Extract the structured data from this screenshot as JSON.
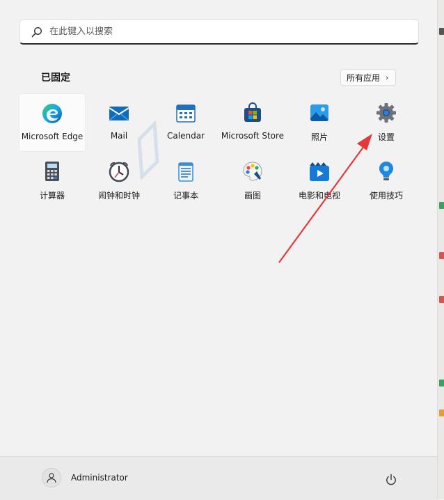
{
  "search": {
    "placeholder": "在此键入以搜索"
  },
  "pinned": {
    "title": "已固定",
    "all_apps_label": "所有应用",
    "apps": [
      {
        "label": "Microsoft Edge",
        "icon": "edge-icon"
      },
      {
        "label": "Mail",
        "icon": "mail-icon"
      },
      {
        "label": "Calendar",
        "icon": "calendar-icon"
      },
      {
        "label": "Microsoft Store",
        "icon": "store-icon"
      },
      {
        "label": "照片",
        "icon": "photos-icon"
      },
      {
        "label": "设置",
        "icon": "settings-gear-icon"
      },
      {
        "label": "计算器",
        "icon": "calculator-icon"
      },
      {
        "label": "闹钟和时钟",
        "icon": "alarm-clock-icon"
      },
      {
        "label": "记事本",
        "icon": "notepad-icon"
      },
      {
        "label": "画图",
        "icon": "paint-palette-icon"
      },
      {
        "label": "电影和电视",
        "icon": "movies-tv-icon"
      },
      {
        "label": "使用技巧",
        "icon": "tips-lightbulb-icon"
      }
    ]
  },
  "user": {
    "name": "Administrator",
    "icon": "user-avatar-icon"
  },
  "power": {
    "icon": "power-icon"
  },
  "colors": {
    "accent": "#0078d4",
    "arrow": "#e23a3a"
  }
}
